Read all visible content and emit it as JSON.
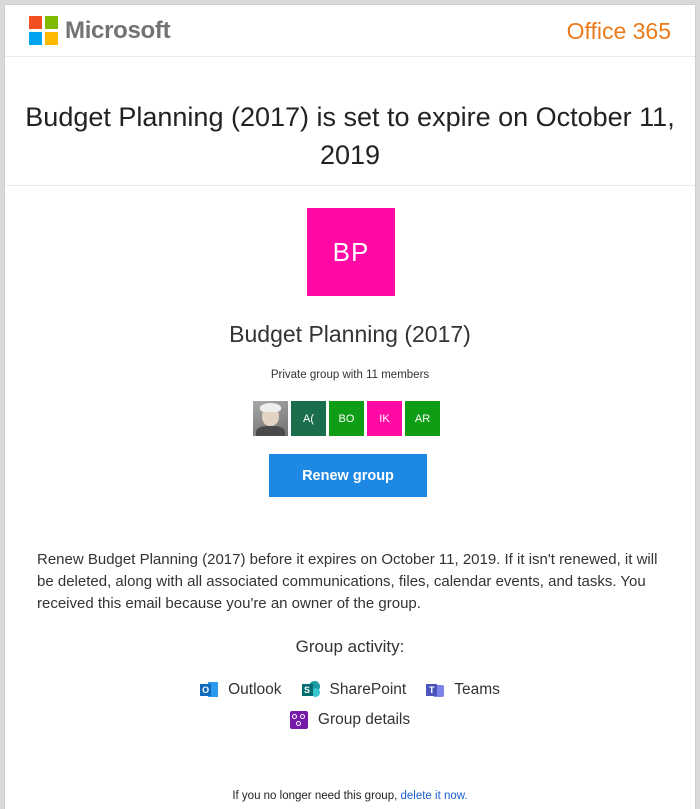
{
  "header": {
    "brand": "Microsoft",
    "product": "Office 365",
    "product_color": "#eb7a1b"
  },
  "title": "Budget Planning (2017) is set to expire on October 11, 2019",
  "group": {
    "initials": "BP",
    "avatar_color": "#ff0aa5",
    "name": "Budget Planning (2017)",
    "meta": "Private group with 11 members",
    "members": [
      {
        "type": "photo",
        "initials": "",
        "color": "#8a8a8a"
      },
      {
        "type": "initials",
        "initials": "A(",
        "color": "#1b6e4b"
      },
      {
        "type": "initials",
        "initials": "BO",
        "color": "#0f9d16"
      },
      {
        "type": "initials",
        "initials": "IK",
        "color": "#ff0aa5"
      },
      {
        "type": "initials",
        "initials": "AR",
        "color": "#0f9d16"
      }
    ]
  },
  "renew_button": "Renew group",
  "body_text": "Renew Budget Planning (2017) before it expires on October 11, 2019. If it isn't renewed, it will be deleted, along with all associated communications, files, calendar events, and tasks. You received this email because you're an owner of the group.",
  "activity": {
    "title": "Group activity:",
    "links": [
      {
        "label": "Outlook",
        "icon": "outlook-icon"
      },
      {
        "label": "SharePoint",
        "icon": "sharepoint-icon"
      },
      {
        "label": "Teams",
        "icon": "teams-icon"
      }
    ],
    "details_label": "Group details",
    "details_icon": "group-details-icon"
  },
  "footer": {
    "text": "If you no longer need this group, ",
    "link": "delete it now."
  }
}
